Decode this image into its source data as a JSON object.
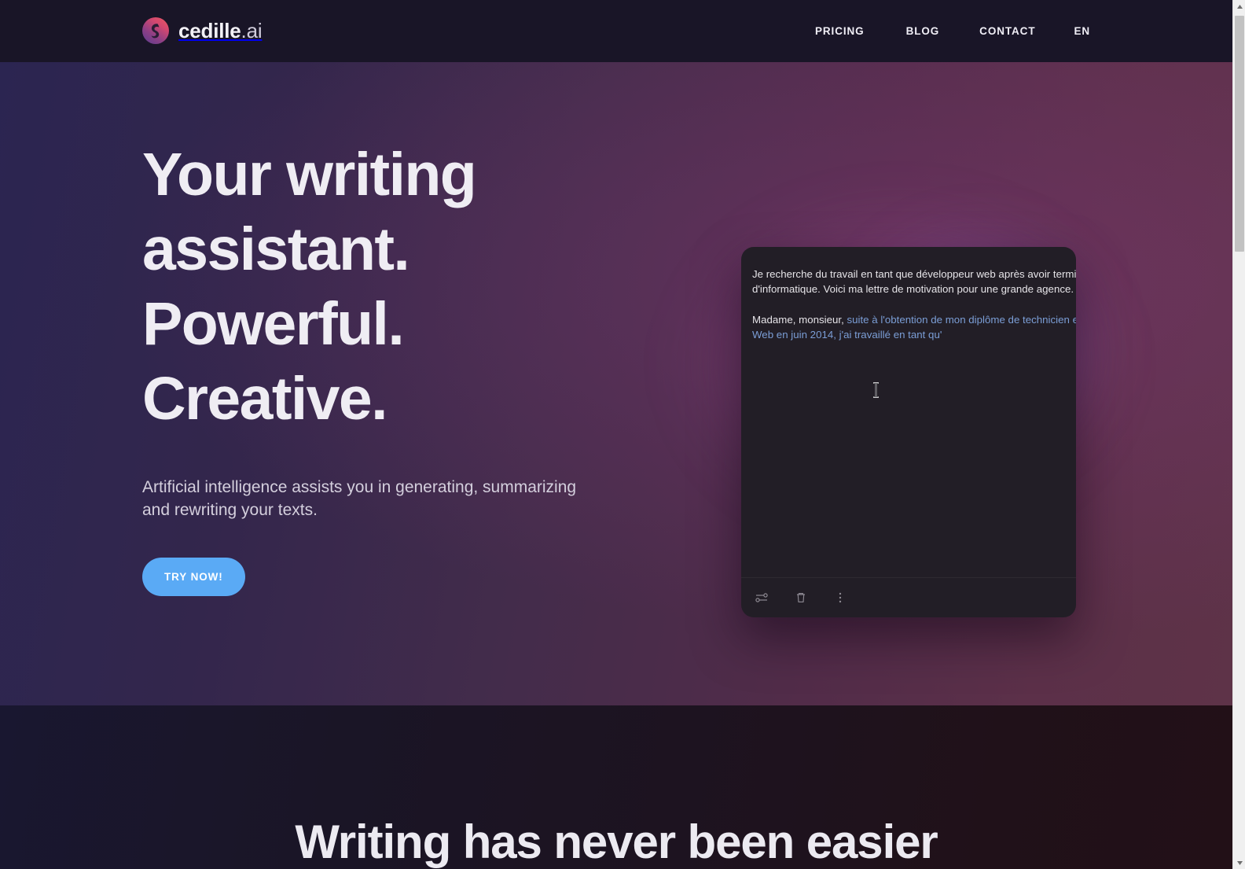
{
  "header": {
    "brand": {
      "name": "cedille",
      "suffix": ".ai",
      "logo_icon": "cedille-swirl-logo"
    },
    "nav": [
      {
        "label": "PRICING",
        "name": "nav-item-pricing"
      },
      {
        "label": "BLOG",
        "name": "nav-item-blog"
      },
      {
        "label": "CONTACT",
        "name": "nav-item-contact"
      },
      {
        "label": "EN",
        "name": "nav-item-language"
      }
    ],
    "background_color": "#191527"
  },
  "hero": {
    "title_lines": [
      "Your writing",
      "assistant.",
      "Powerful.",
      "Creative."
    ],
    "title_full": "Your writing assistant. Powerful. Creative.",
    "subtitle": "Artificial intelligence assists you in generating, summarizing and rewriting your texts.",
    "cta_label": "TRY NOW!",
    "cta_color": "#5aaaf5",
    "gradient_from": "#2b2551",
    "gradient_to": "#5e3348",
    "glow_color": "#f096d7"
  },
  "editor": {
    "card_background": "#221e26",
    "prompt_text": "Je recherche du travail en tant que développeur web après avoir terminé mes études d'informatique. Voici ma lettre de motivation pour une grande agence.",
    "generated_prefix": "Madame, monsieur, ",
    "generated_text": "suite à l'obtention de mon diplôme de technicien en informatique option Web en juin 2014, j'ai travaillé en tant qu'",
    "generated_color": "#7b9ed6",
    "caret_icon": "text-ibeam-cursor",
    "toolbar": [
      {
        "label": "Settings",
        "name": "tune-sliders-icon"
      },
      {
        "label": "Delete",
        "name": "trash-icon"
      },
      {
        "label": "More options",
        "name": "more-vertical-icon"
      }
    ]
  },
  "next_section": {
    "title": "Writing has never been easier"
  },
  "scrollbar": {
    "up_arrow_icon": "caret-up-icon",
    "down_arrow_icon": "caret-down-icon",
    "thumb_name": "scrollbar-thumb"
  }
}
